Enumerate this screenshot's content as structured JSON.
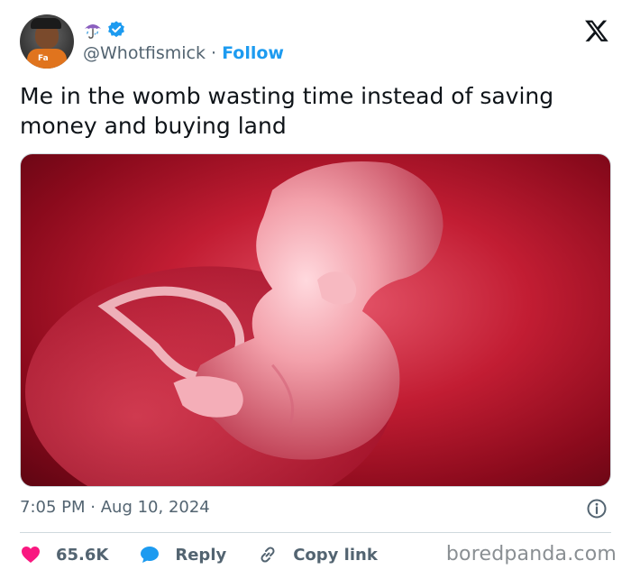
{
  "author": {
    "handle": "@Whotfismick",
    "separator": "·",
    "follow_label": "Follow",
    "avatar_shirt_text": "Fa"
  },
  "tweet": {
    "text": "Me in the womb wasting time instead of saving money and buying land",
    "time": "7:05 PM",
    "date_separator": "·",
    "date": "Aug 10, 2024"
  },
  "actions": {
    "likes": "65.6K",
    "reply_label": "Reply",
    "copy_link_label": "Copy link"
  },
  "watermark": "boredpanda.com",
  "colors": {
    "follow": "#1d9bf0",
    "like": "#f91880",
    "reply": "#1d9bf0",
    "muted": "#536471",
    "verified": "#1d9bf0"
  },
  "icons": {
    "platform": "x-logo-icon",
    "verified": "verified-badge-icon",
    "emoji": "umbrella-emoji-icon",
    "info": "info-icon",
    "like": "heart-icon",
    "reply": "speech-bubble-icon",
    "copy": "link-icon"
  }
}
